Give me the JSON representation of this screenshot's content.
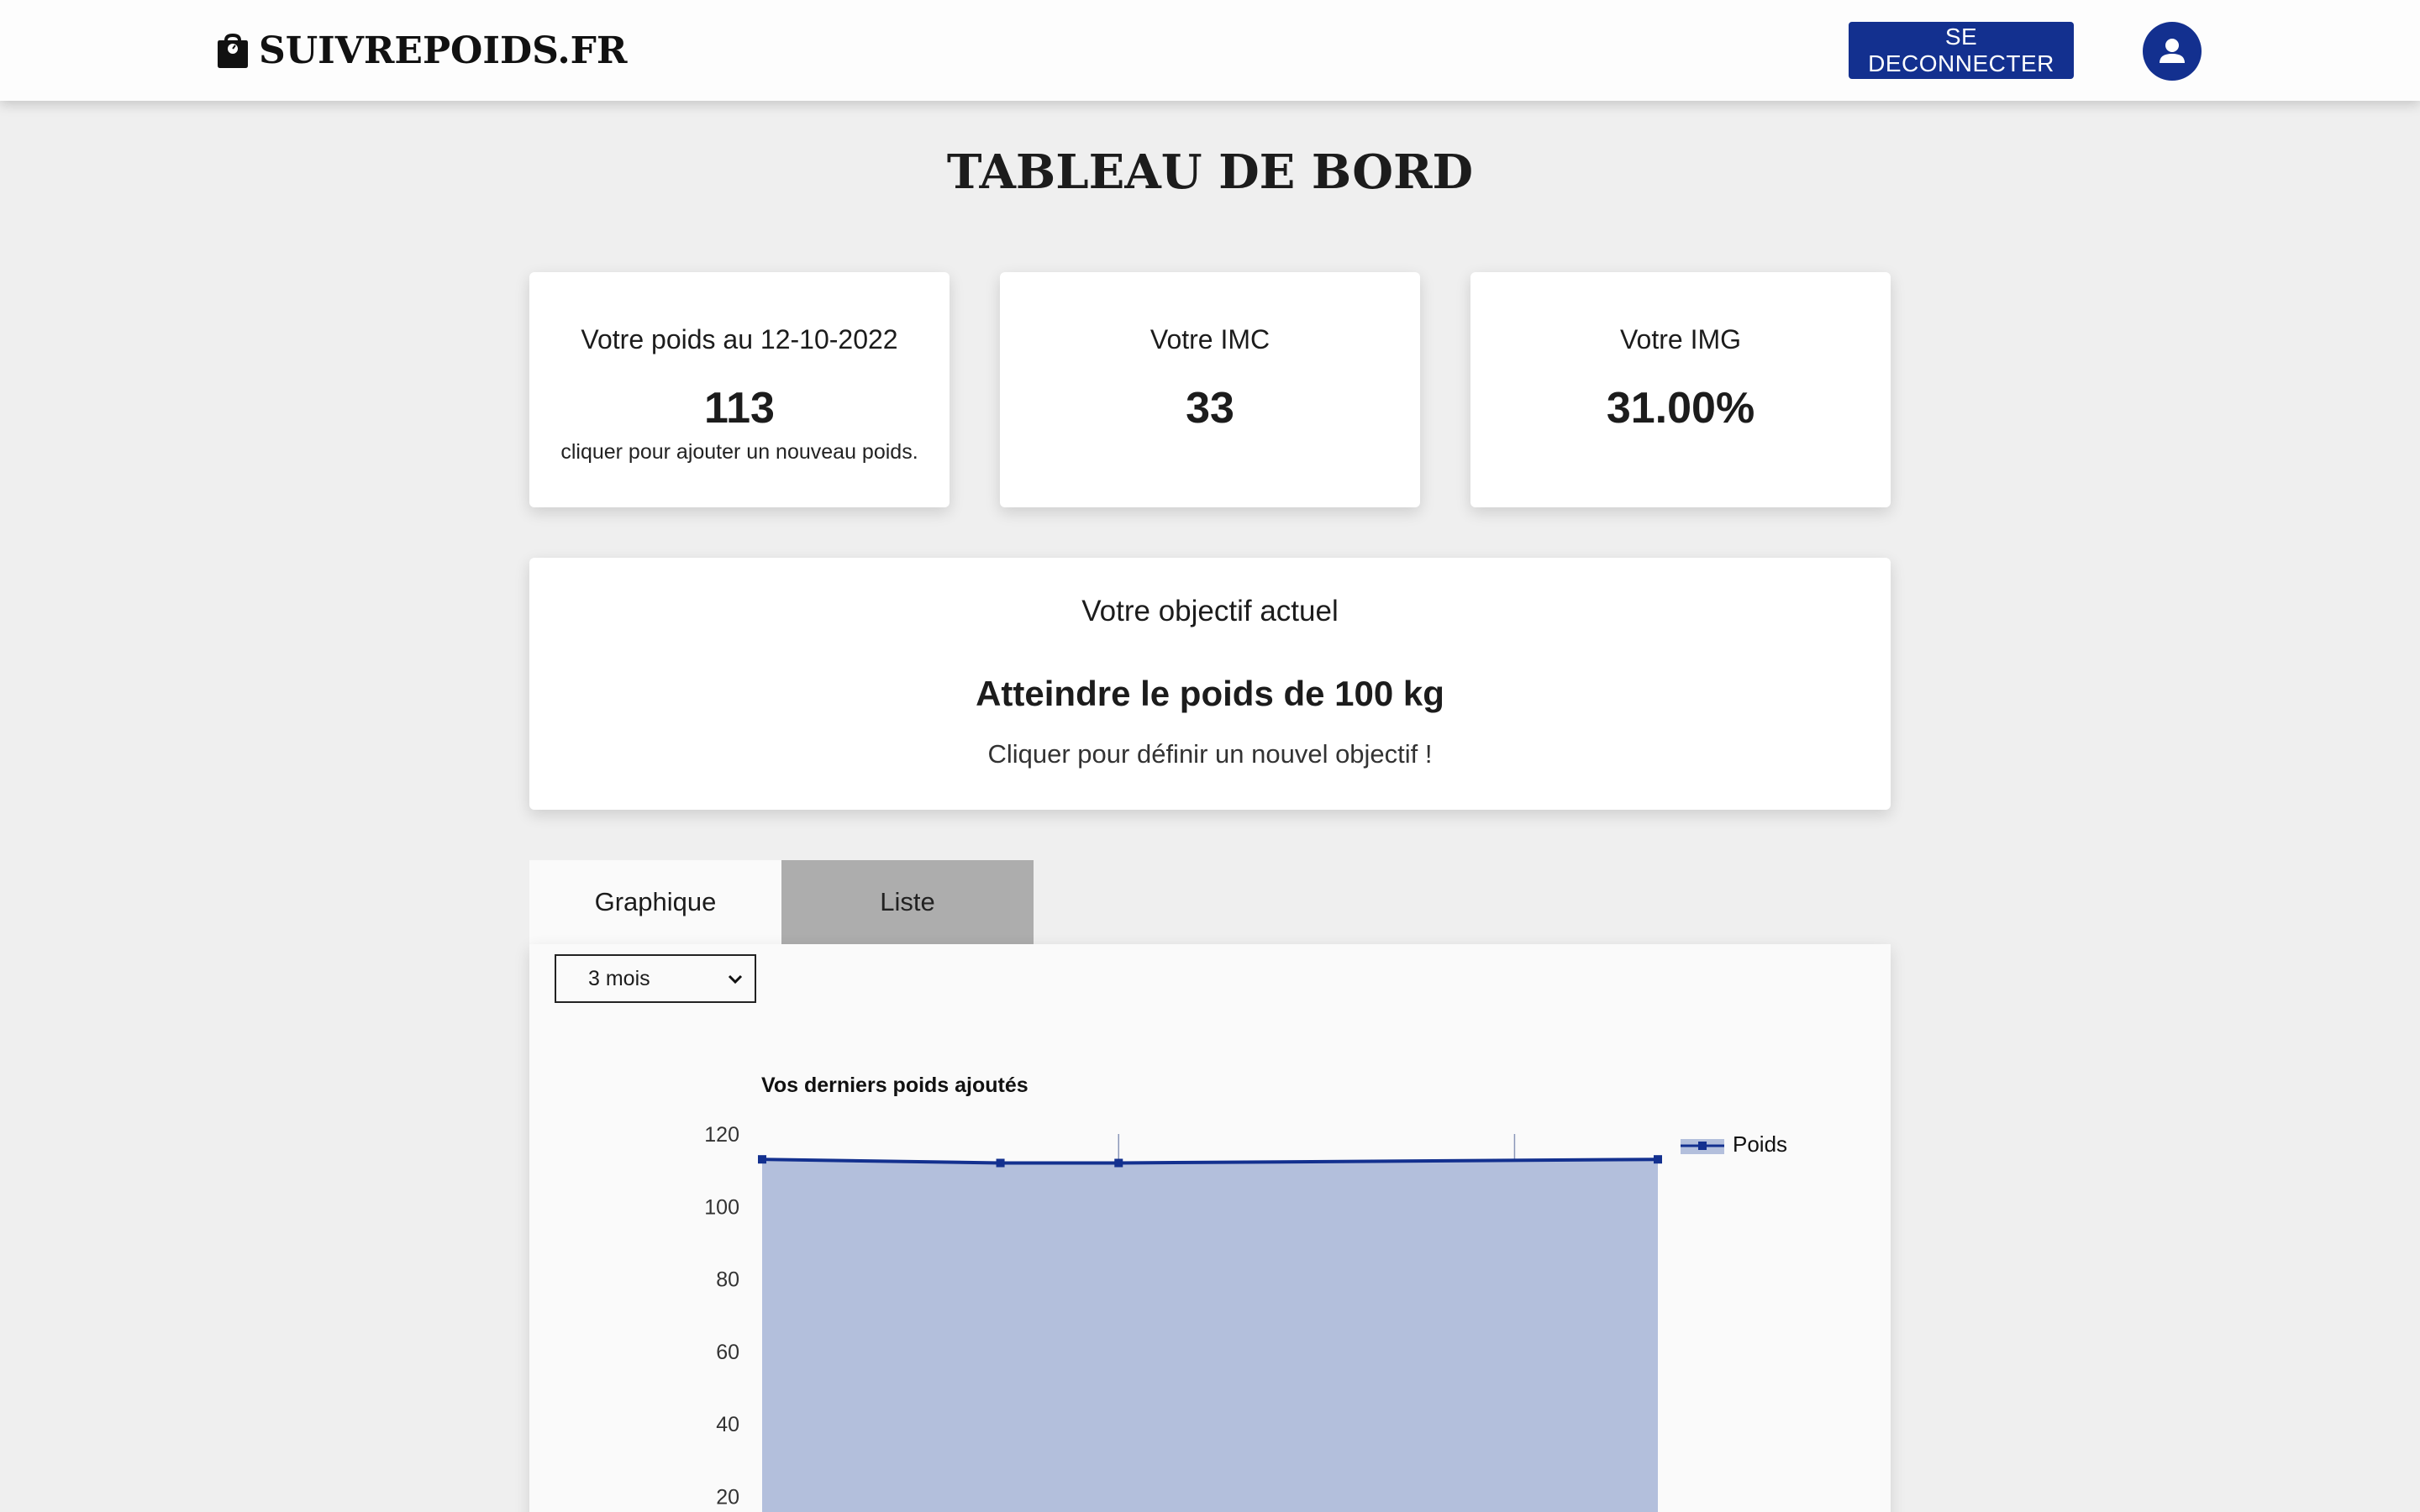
{
  "header": {
    "brand": "SUIVREPOIDS.FR",
    "logout_label": "SE DECONNECTER",
    "brand_icon": "weight-scale-icon",
    "avatar_icon": "user-circle-icon"
  },
  "page_title": "TABLEAU DE BORD",
  "stats": {
    "weight": {
      "label": "Votre poids au 12-10-2022",
      "value": "113",
      "hint": "cliquer pour ajouter un nouveau poids."
    },
    "imc": {
      "label": "Votre IMC",
      "value": "33"
    },
    "img": {
      "label": "Votre IMG",
      "value": "31.00%"
    }
  },
  "goal": {
    "title": "Votre objectif actuel",
    "value": "Atteindre le poids de 100 kg",
    "hint": "Cliquer pour définir un nouvel objectif !"
  },
  "tabs": {
    "graph": "Graphique",
    "list": "Liste"
  },
  "period_select": {
    "selected": "3 mois"
  },
  "colors": {
    "brand": "#13308f",
    "area_fill": "#b3bfdc",
    "line": "#13308f"
  },
  "chart_data": {
    "type": "area",
    "title": "Vos derniers poids ajoutés",
    "series": [
      {
        "name": "Poids",
        "values": [
          113,
          112,
          112,
          113
        ]
      }
    ],
    "x_fraction": [
      0,
      0.266,
      0.398,
      1
    ],
    "ylim": [
      0,
      120
    ],
    "yticks": [
      "120",
      "100",
      "80",
      "60",
      "40",
      "20"
    ],
    "grid": true,
    "legend": "top-right"
  }
}
